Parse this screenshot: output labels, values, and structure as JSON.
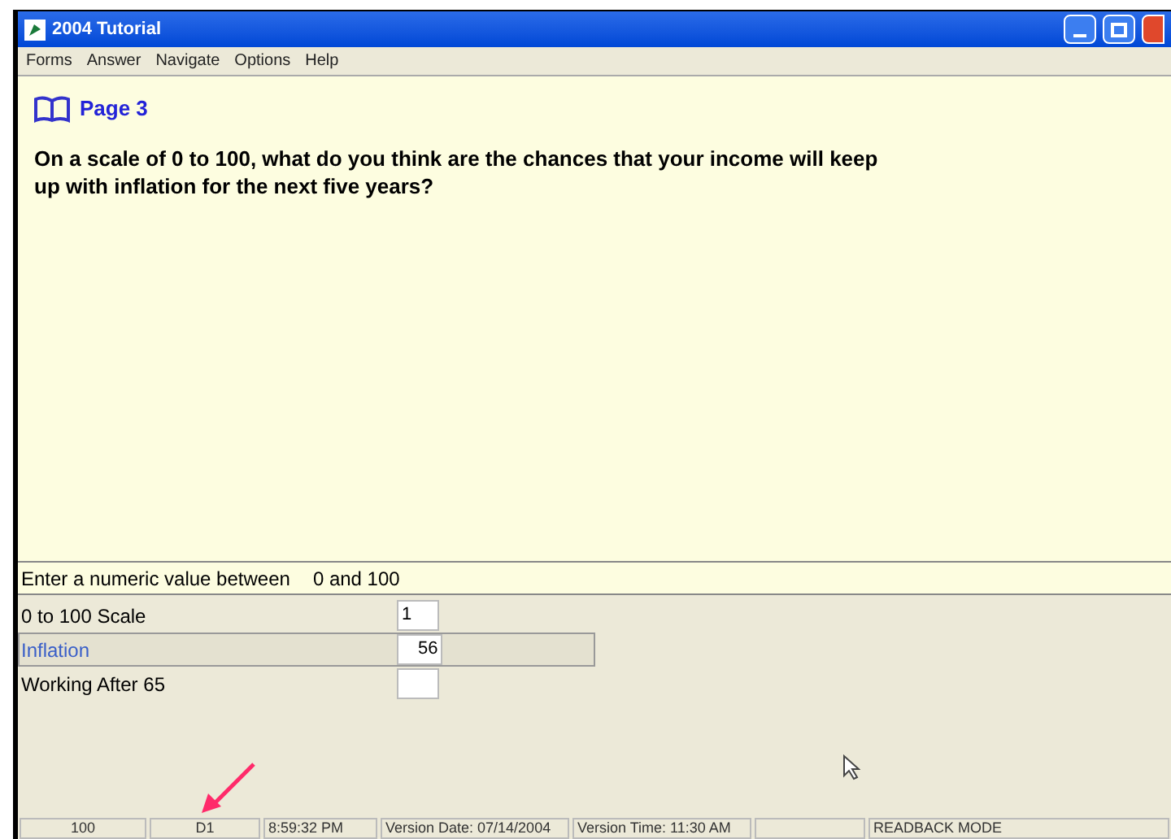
{
  "window": {
    "title": "2004 Tutorial"
  },
  "menu": [
    "Forms",
    "Answer",
    "Navigate",
    "Options",
    "Help"
  ],
  "page": {
    "title": "Page 3",
    "question": "On a scale of 0 to 100, what do you think are the chances that your income will keep up with inflation for the next five years?"
  },
  "prompt": {
    "text": "Enter a numeric value between",
    "range": "0 and 100"
  },
  "fields": [
    {
      "label": "0 to 100 Scale",
      "value": "1",
      "selected": false
    },
    {
      "label": "Inflation",
      "value": "56",
      "selected": true
    },
    {
      "label": "Working After 65",
      "selected": false
    }
  ],
  "status_bar": [
    {
      "kind": "text",
      "text": "100"
    },
    {
      "kind": "text",
      "text": "D1"
    },
    {
      "kind": "text",
      "text": "8:59:32 PM"
    },
    {
      "kind": "text",
      "text": "Version Date: 07/14/2004"
    },
    {
      "kind": "text",
      "text": "Version Time: 11:30 AM"
    },
    {
      "kind": "blank"
    },
    {
      "kind": "text",
      "text": "READBACK MODE"
    }
  ]
}
